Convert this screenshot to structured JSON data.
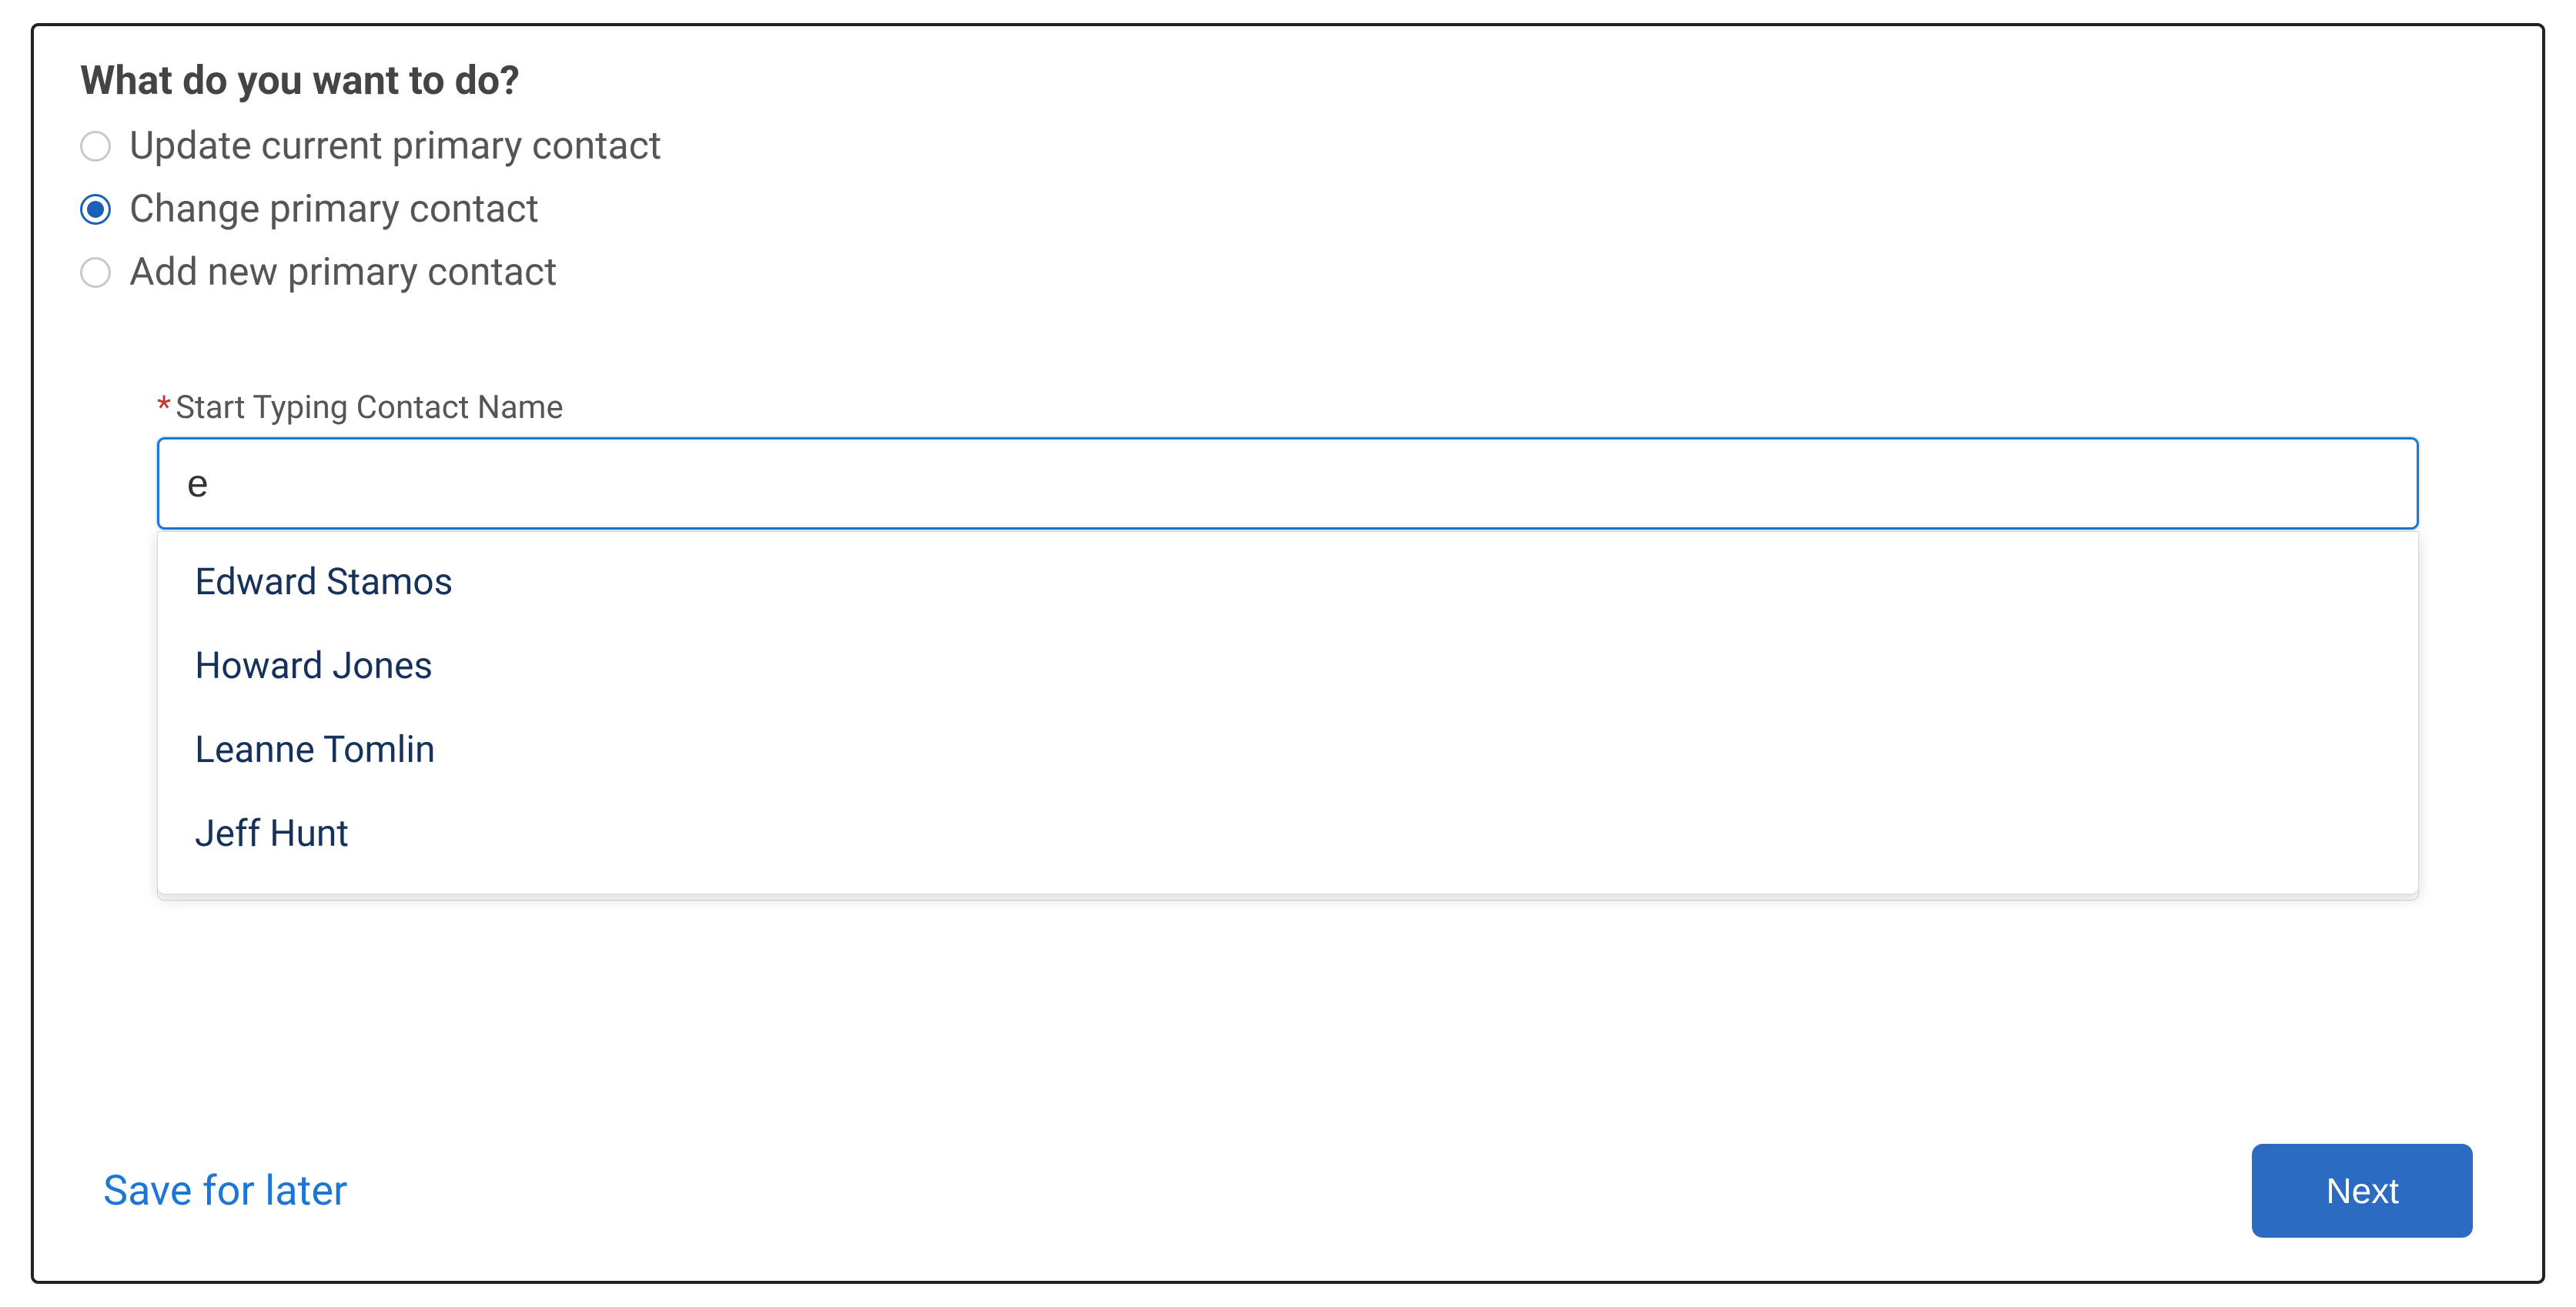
{
  "question": "What do you want to do?",
  "options": {
    "0": {
      "label": "Update current primary contact",
      "selected": false
    },
    "1": {
      "label": "Change primary contact",
      "selected": true
    },
    "2": {
      "label": "Add new primary contact",
      "selected": false
    }
  },
  "field": {
    "label": "Start Typing Contact Name",
    "required_marker": "*",
    "value": "e"
  },
  "suggestions": {
    "0": "Edward Stamos",
    "1": "Howard Jones",
    "2": "Leanne Tomlin",
    "3": "Jeff Hunt"
  },
  "footer": {
    "save_label": "Save for later",
    "next_label": "Next"
  }
}
